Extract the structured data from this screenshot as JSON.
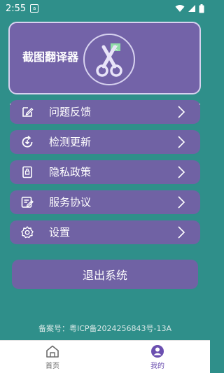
{
  "status_bar": {
    "time": "2:55",
    "notification_icon": "a"
  },
  "app": {
    "name": "截图翻译器",
    "logo_icon": "scissors-translate-icon"
  },
  "menu": [
    {
      "label": "问题反馈",
      "icon": "feedback-edit-icon"
    },
    {
      "label": "检测更新",
      "icon": "update-check-icon"
    },
    {
      "label": "隐私政策",
      "icon": "privacy-policy-icon"
    },
    {
      "label": "服务协议",
      "icon": "service-agreement-icon"
    },
    {
      "label": "设置",
      "icon": "gear-icon"
    }
  ],
  "logout_label": "退出系统",
  "icp": "备案号：粤ICP备2024256843号-13A",
  "nav": {
    "home_label": "首页",
    "mine_label": "我的",
    "active": "mine"
  },
  "colors": {
    "background": "#2f8f8a",
    "card": "#7062a4",
    "active_tab": "#6b4fb0"
  }
}
